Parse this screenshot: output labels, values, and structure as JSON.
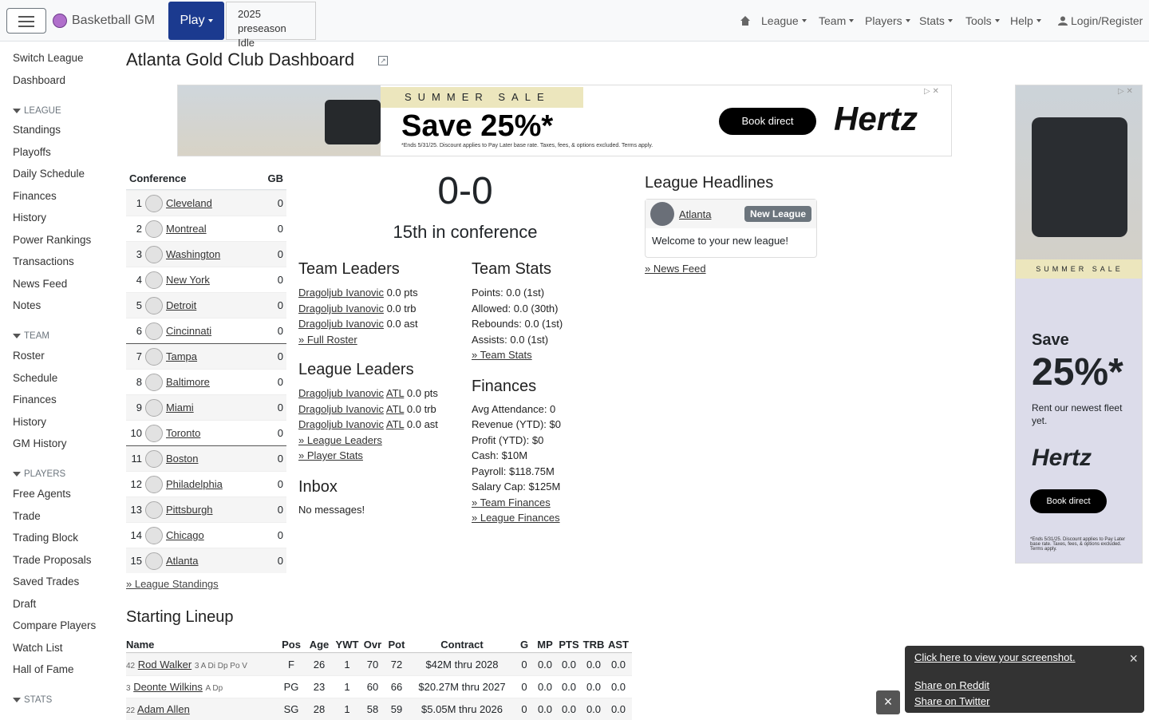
{
  "nav": {
    "brand": "Basketball GM",
    "play": "Play",
    "season": "2025 preseason",
    "status": "Idle",
    "menus": [
      "League",
      "Team",
      "Players",
      "Stats",
      "Tools",
      "Help"
    ],
    "login": "Login/Register"
  },
  "sidebar": {
    "top": [
      "Switch League",
      "Dashboard"
    ],
    "league_head": "LEAGUE",
    "league": [
      "Standings",
      "Playoffs",
      "Daily Schedule",
      "Finances",
      "History",
      "Power Rankings",
      "Transactions",
      "News Feed",
      "Notes"
    ],
    "team_head": "TEAM",
    "team": [
      "Roster",
      "Schedule",
      "Finances",
      "History",
      "GM History"
    ],
    "players_head": "PLAYERS",
    "players": [
      "Free Agents",
      "Trade",
      "Trading Block",
      "Trade Proposals",
      "Saved Trades",
      "Draft",
      "Compare Players",
      "Watch List",
      "Hall of Fame"
    ],
    "stats_head": "STATS"
  },
  "page": {
    "title": "Atlanta Gold Club Dashboard"
  },
  "ad_top": {
    "band": "SUMMER SALE",
    "save": "Save 25%*",
    "fine": "*Ends 5/31/25. Discount applies to Pay Later base rate. Taxes, fees, & options excluded. Terms apply.",
    "button": "Book direct",
    "logo": "Hertz"
  },
  "ad_side": {
    "band": "SUMMER SALE",
    "save": "Save",
    "pct": "25%*",
    "rent": "Rent our newest fleet yet.",
    "logo": "Hertz",
    "button": "Book direct",
    "fine": "*Ends 5/31/25. Discount applies to Pay Later base rate. Taxes, fees, & options excluded. Terms apply."
  },
  "standings": {
    "header_conf": "Conference",
    "header_gb": "GB",
    "rows": [
      {
        "rank": "1",
        "team": "Cleveland",
        "gb": "0"
      },
      {
        "rank": "2",
        "team": "Montreal",
        "gb": "0"
      },
      {
        "rank": "3",
        "team": "Washington",
        "gb": "0"
      },
      {
        "rank": "4",
        "team": "New York",
        "gb": "0"
      },
      {
        "rank": "5",
        "team": "Detroit",
        "gb": "0"
      },
      {
        "rank": "6",
        "team": "Cincinnati",
        "gb": "0"
      },
      {
        "rank": "7",
        "team": "Tampa",
        "gb": "0"
      },
      {
        "rank": "8",
        "team": "Baltimore",
        "gb": "0"
      },
      {
        "rank": "9",
        "team": "Miami",
        "gb": "0"
      },
      {
        "rank": "10",
        "team": "Toronto",
        "gb": "0"
      },
      {
        "rank": "11",
        "team": "Boston",
        "gb": "0"
      },
      {
        "rank": "12",
        "team": "Philadelphia",
        "gb": "0"
      },
      {
        "rank": "13",
        "team": "Pittsburgh",
        "gb": "0"
      },
      {
        "rank": "14",
        "team": "Chicago",
        "gb": "0"
      },
      {
        "rank": "15",
        "team": "Atlanta",
        "gb": "0"
      }
    ],
    "link": "» League Standings"
  },
  "record": "0-0",
  "conf_rank": "15th in conference",
  "team_leaders": {
    "title": "Team Leaders",
    "rows": [
      {
        "player": "Dragoljub Ivanovic",
        "val": "0.0 pts"
      },
      {
        "player": "Dragoljub Ivanovic",
        "val": "0.0 trb"
      },
      {
        "player": "Dragoljub Ivanovic",
        "val": "0.0 ast"
      }
    ],
    "link": "» Full Roster"
  },
  "league_leaders": {
    "title": "League Leaders",
    "rows": [
      {
        "player": "Dragoljub Ivanovic",
        "team": "ATL",
        "val": "0.0 pts"
      },
      {
        "player": "Dragoljub Ivanovic",
        "team": "ATL",
        "val": "0.0 trb"
      },
      {
        "player": "Dragoljub Ivanovic",
        "team": "ATL",
        "val": "0.0 ast"
      }
    ],
    "link1": "» League Leaders",
    "link2": "» Player Stats"
  },
  "team_stats": {
    "title": "Team Stats",
    "rows": [
      "Points: 0.0 (1st)",
      "Allowed: 0.0 (30th)",
      "Rebounds: 0.0 (1st)",
      "Assists: 0.0 (1st)"
    ],
    "link": "» Team Stats"
  },
  "finances": {
    "title": "Finances",
    "rows": [
      "Avg Attendance: 0",
      "Revenue (YTD): $0",
      "Profit (YTD): $0",
      "Cash: $10M",
      "Payroll: $118.75M",
      "Salary Cap: $125M"
    ],
    "link1": "» Team Finances",
    "link2": "» League Finances"
  },
  "inbox": {
    "title": "Inbox",
    "text": "No messages!"
  },
  "headlines": {
    "title": "League Headlines",
    "team": "Atlanta",
    "badge": "New League",
    "text": "Welcome to your new league!",
    "link": "» News Feed"
  },
  "lineup": {
    "title": "Starting Lineup",
    "headers": [
      "Name",
      "Pos",
      "Age",
      "YWT",
      "Ovr",
      "Pot",
      "Contract",
      "G",
      "MP",
      "PTS",
      "TRB",
      "AST"
    ],
    "rows": [
      {
        "num": "42",
        "name": "Rod Walker",
        "skills": "3 A Di Dp Po V",
        "pos": "F",
        "age": "26",
        "ywt": "1",
        "ovr": "70",
        "pot": "72",
        "contract": "$42M thru 2028",
        "g": "0",
        "mp": "0.0",
        "pts": "0.0",
        "trb": "0.0",
        "ast": "0.0"
      },
      {
        "num": "3",
        "name": "Deonte Wilkins",
        "skills": "A Dp",
        "pos": "PG",
        "age": "23",
        "ywt": "1",
        "ovr": "60",
        "pot": "66",
        "contract": "$20.27M thru 2027",
        "g": "0",
        "mp": "0.0",
        "pts": "0.0",
        "trb": "0.0",
        "ast": "0.0"
      },
      {
        "num": "22",
        "name": "Adam Allen",
        "skills": "",
        "pos": "SG",
        "age": "28",
        "ywt": "1",
        "ovr": "58",
        "pot": "59",
        "contract": "$5.05M thru 2026",
        "g": "0",
        "mp": "0.0",
        "pts": "0.0",
        "trb": "0.0",
        "ast": "0.0"
      }
    ]
  },
  "share": {
    "screenshot": "Click here to view your screenshot.",
    "reddit": "Share on Reddit",
    "twitter": "Share on Twitter",
    "close": "×"
  }
}
